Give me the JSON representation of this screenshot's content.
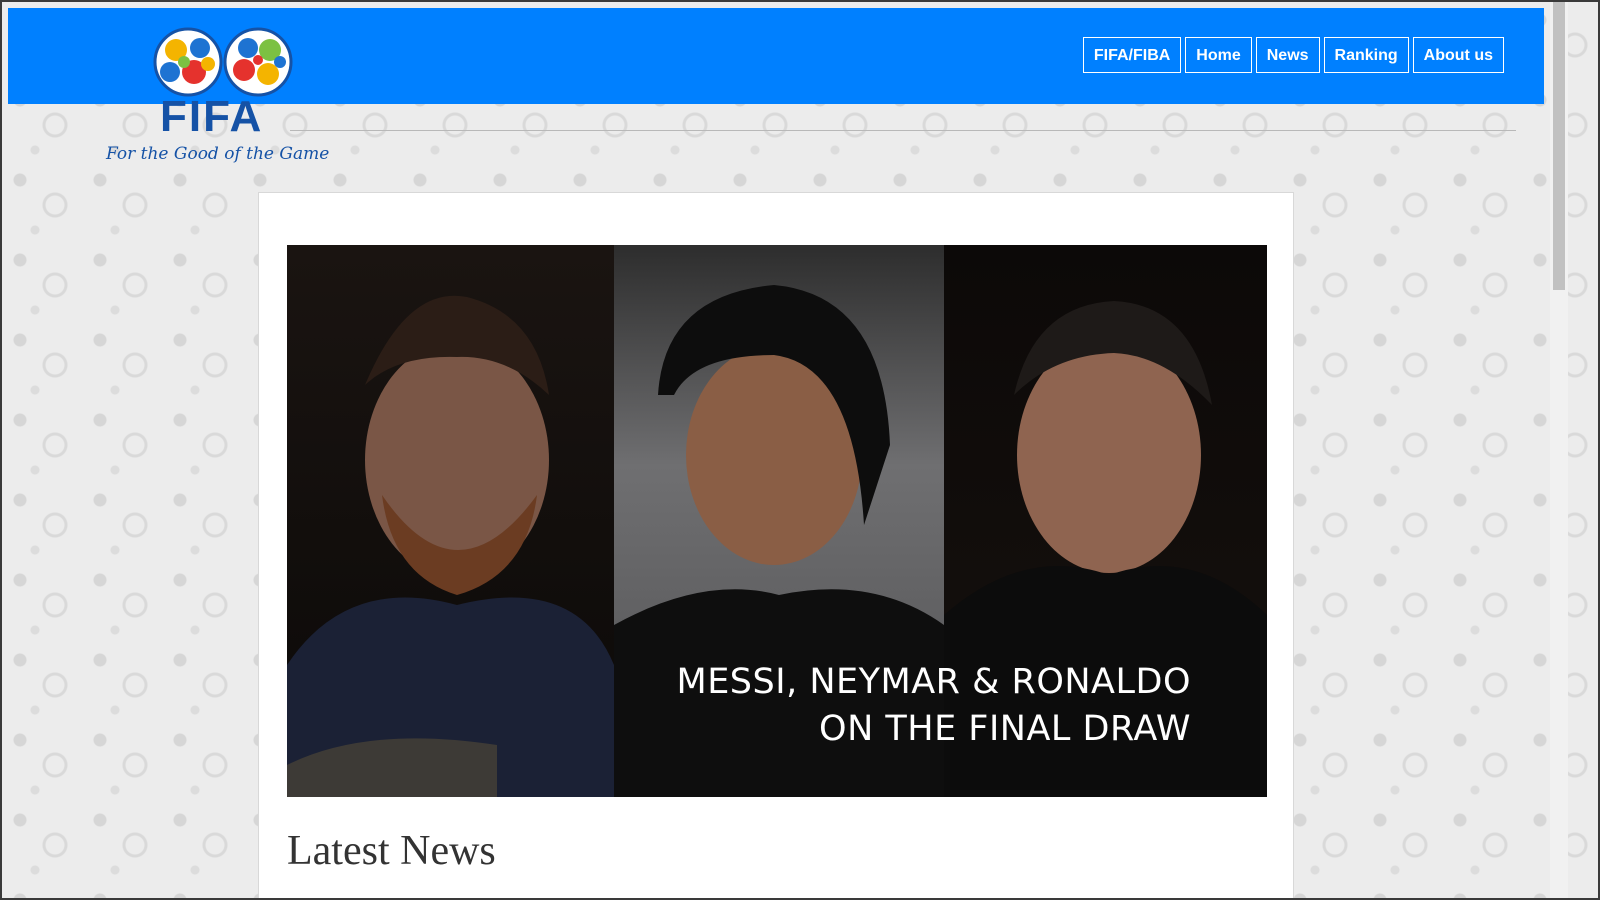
{
  "brand": {
    "wordmark": "FIFA",
    "tagline": "For the Good of the Game",
    "logo_colors": [
      "#f4b400",
      "#e5322d",
      "#1e73d2",
      "#7cc142"
    ],
    "text_color": "#1552a6"
  },
  "navbar": {
    "background": "#0080ff",
    "links": [
      {
        "label": "FIFA/FIBA"
      },
      {
        "label": "Home"
      },
      {
        "label": "News"
      },
      {
        "label": "Ranking"
      },
      {
        "label": "About us"
      }
    ]
  },
  "hero": {
    "caption_line1": "MESSI, NEYMAR & RONALDO",
    "caption_line2": "ON THE FINAL DRAW"
  },
  "main": {
    "section_title": "Latest News"
  }
}
